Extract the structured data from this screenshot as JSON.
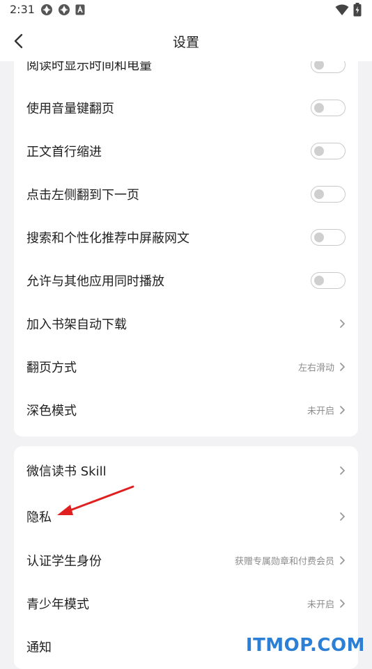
{
  "status_bar": {
    "time": "2:31",
    "icons_left": [
      "sync-icon",
      "sync-icon",
      "app-a-icon"
    ],
    "icons_right": [
      "wifi-icon",
      "battery-charging-icon"
    ]
  },
  "header": {
    "title": "设置",
    "back_icon": "chevron-left-icon"
  },
  "group1": {
    "items": [
      {
        "label": "阅读时显示时间和电量",
        "control": "toggle",
        "on": false
      },
      {
        "label": "使用音量键翻页",
        "control": "toggle",
        "on": false
      },
      {
        "label": "正文首行缩进",
        "control": "toggle",
        "on": false
      },
      {
        "label": "点击左侧翻到下一页",
        "control": "toggle",
        "on": false
      },
      {
        "label": "搜索和个性化推荐中屏蔽网文",
        "control": "toggle",
        "on": false
      },
      {
        "label": "允许与其他应用同时播放",
        "control": "toggle",
        "on": false
      },
      {
        "label": "加入书架自动下载",
        "control": "chevron",
        "value": ""
      },
      {
        "label": "翻页方式",
        "control": "chevron",
        "value": "左右滑动"
      },
      {
        "label": "深色模式",
        "control": "chevron",
        "value": "未开启"
      }
    ]
  },
  "group2": {
    "items": [
      {
        "label": "微信读书 Skill",
        "value": ""
      },
      {
        "label": "隐私",
        "value": ""
      },
      {
        "label": "认证学生身份",
        "value": "获赠专属勋章和付费会员"
      },
      {
        "label": "青少年模式",
        "value": "未开启"
      },
      {
        "label": "通知",
        "value": ""
      }
    ]
  },
  "annotation": {
    "color": "#e02020",
    "icon": "red-arrow-icon"
  },
  "watermark": {
    "text": "ITMOP.COM",
    "color": "#2b7fd6"
  },
  "colors": {
    "background": "#f2f2f4",
    "card": "#ffffff",
    "toggle_off_border": "#c9c9c9",
    "secondary_text": "#8c8c8c"
  }
}
